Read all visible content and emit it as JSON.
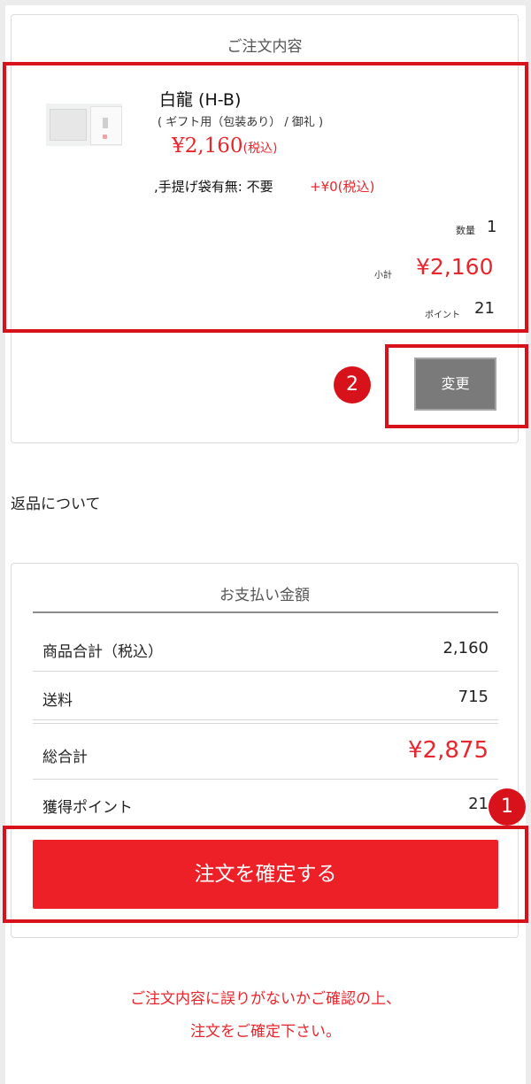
{
  "order": {
    "title": "ご注文内容",
    "item": {
      "name": "白龍 (H-B)",
      "option": "( ギフト用（包装あり） / 御礼 )",
      "price": "¥2,160",
      "price_tax": "(税込)",
      "bag_label": ",手提げ袋有無: 不要",
      "bag_price": "+¥0(税込)"
    },
    "quantity_label": "数量",
    "quantity": "1",
    "subtotal_label": "小計",
    "subtotal": "¥2,160",
    "points_label": "ポイント",
    "points": "21",
    "change_button": "変更"
  },
  "returns_link": "返品について",
  "payment": {
    "title": "お支払い金額",
    "rows": [
      {
        "label": "商品合計（税込）",
        "value": "2,160"
      },
      {
        "label": "送料",
        "value": "715"
      },
      {
        "label": "総合計",
        "value": "¥2,875"
      },
      {
        "label": "獲得ポイント",
        "value": "21"
      }
    ],
    "confirm_button": "注文を確定する"
  },
  "notice": {
    "line1": "ご注文内容に誤りがないかご確認の上、",
    "line2": "注文をご確定下さい。"
  },
  "badges": {
    "first": "1",
    "second": "2"
  },
  "colors": {
    "accent": "#e8262d",
    "highlight": "#d8121a",
    "button_gray": "#7a7a7a"
  },
  "icons": {
    "product": "product-thumbnail"
  }
}
